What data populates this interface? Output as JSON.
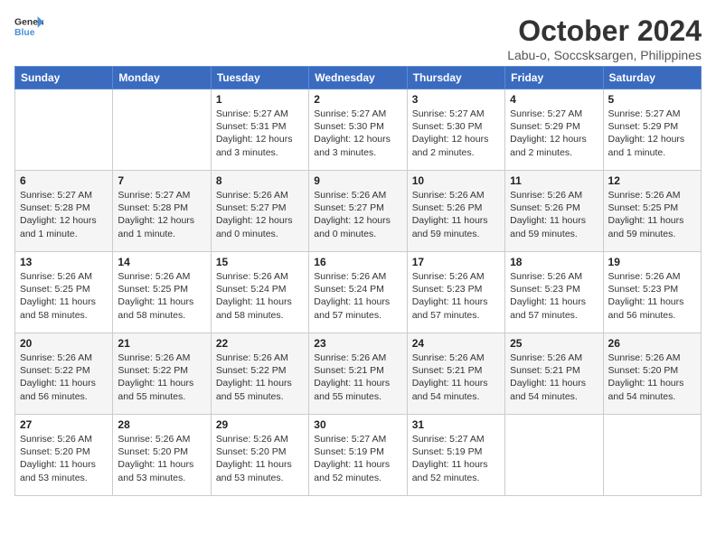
{
  "logo": {
    "line1": "General",
    "line2": "Blue"
  },
  "title": "October 2024",
  "subtitle": "Labu-o, Soccsksargen, Philippines",
  "headers": [
    "Sunday",
    "Monday",
    "Tuesday",
    "Wednesday",
    "Thursday",
    "Friday",
    "Saturday"
  ],
  "weeks": [
    [
      {
        "day": "",
        "info": ""
      },
      {
        "day": "",
        "info": ""
      },
      {
        "day": "1",
        "info": "Sunrise: 5:27 AM\nSunset: 5:31 PM\nDaylight: 12 hours\nand 3 minutes."
      },
      {
        "day": "2",
        "info": "Sunrise: 5:27 AM\nSunset: 5:30 PM\nDaylight: 12 hours\nand 3 minutes."
      },
      {
        "day": "3",
        "info": "Sunrise: 5:27 AM\nSunset: 5:30 PM\nDaylight: 12 hours\nand 2 minutes."
      },
      {
        "day": "4",
        "info": "Sunrise: 5:27 AM\nSunset: 5:29 PM\nDaylight: 12 hours\nand 2 minutes."
      },
      {
        "day": "5",
        "info": "Sunrise: 5:27 AM\nSunset: 5:29 PM\nDaylight: 12 hours\nand 1 minute."
      }
    ],
    [
      {
        "day": "6",
        "info": "Sunrise: 5:27 AM\nSunset: 5:28 PM\nDaylight: 12 hours\nand 1 minute."
      },
      {
        "day": "7",
        "info": "Sunrise: 5:27 AM\nSunset: 5:28 PM\nDaylight: 12 hours\nand 1 minute."
      },
      {
        "day": "8",
        "info": "Sunrise: 5:26 AM\nSunset: 5:27 PM\nDaylight: 12 hours\nand 0 minutes."
      },
      {
        "day": "9",
        "info": "Sunrise: 5:26 AM\nSunset: 5:27 PM\nDaylight: 12 hours\nand 0 minutes."
      },
      {
        "day": "10",
        "info": "Sunrise: 5:26 AM\nSunset: 5:26 PM\nDaylight: 11 hours\nand 59 minutes."
      },
      {
        "day": "11",
        "info": "Sunrise: 5:26 AM\nSunset: 5:26 PM\nDaylight: 11 hours\nand 59 minutes."
      },
      {
        "day": "12",
        "info": "Sunrise: 5:26 AM\nSunset: 5:25 PM\nDaylight: 11 hours\nand 59 minutes."
      }
    ],
    [
      {
        "day": "13",
        "info": "Sunrise: 5:26 AM\nSunset: 5:25 PM\nDaylight: 11 hours\nand 58 minutes."
      },
      {
        "day": "14",
        "info": "Sunrise: 5:26 AM\nSunset: 5:25 PM\nDaylight: 11 hours\nand 58 minutes."
      },
      {
        "day": "15",
        "info": "Sunrise: 5:26 AM\nSunset: 5:24 PM\nDaylight: 11 hours\nand 58 minutes."
      },
      {
        "day": "16",
        "info": "Sunrise: 5:26 AM\nSunset: 5:24 PM\nDaylight: 11 hours\nand 57 minutes."
      },
      {
        "day": "17",
        "info": "Sunrise: 5:26 AM\nSunset: 5:23 PM\nDaylight: 11 hours\nand 57 minutes."
      },
      {
        "day": "18",
        "info": "Sunrise: 5:26 AM\nSunset: 5:23 PM\nDaylight: 11 hours\nand 57 minutes."
      },
      {
        "day": "19",
        "info": "Sunrise: 5:26 AM\nSunset: 5:23 PM\nDaylight: 11 hours\nand 56 minutes."
      }
    ],
    [
      {
        "day": "20",
        "info": "Sunrise: 5:26 AM\nSunset: 5:22 PM\nDaylight: 11 hours\nand 56 minutes."
      },
      {
        "day": "21",
        "info": "Sunrise: 5:26 AM\nSunset: 5:22 PM\nDaylight: 11 hours\nand 55 minutes."
      },
      {
        "day": "22",
        "info": "Sunrise: 5:26 AM\nSunset: 5:22 PM\nDaylight: 11 hours\nand 55 minutes."
      },
      {
        "day": "23",
        "info": "Sunrise: 5:26 AM\nSunset: 5:21 PM\nDaylight: 11 hours\nand 55 minutes."
      },
      {
        "day": "24",
        "info": "Sunrise: 5:26 AM\nSunset: 5:21 PM\nDaylight: 11 hours\nand 54 minutes."
      },
      {
        "day": "25",
        "info": "Sunrise: 5:26 AM\nSunset: 5:21 PM\nDaylight: 11 hours\nand 54 minutes."
      },
      {
        "day": "26",
        "info": "Sunrise: 5:26 AM\nSunset: 5:20 PM\nDaylight: 11 hours\nand 54 minutes."
      }
    ],
    [
      {
        "day": "27",
        "info": "Sunrise: 5:26 AM\nSunset: 5:20 PM\nDaylight: 11 hours\nand 53 minutes."
      },
      {
        "day": "28",
        "info": "Sunrise: 5:26 AM\nSunset: 5:20 PM\nDaylight: 11 hours\nand 53 minutes."
      },
      {
        "day": "29",
        "info": "Sunrise: 5:26 AM\nSunset: 5:20 PM\nDaylight: 11 hours\nand 53 minutes."
      },
      {
        "day": "30",
        "info": "Sunrise: 5:27 AM\nSunset: 5:19 PM\nDaylight: 11 hours\nand 52 minutes."
      },
      {
        "day": "31",
        "info": "Sunrise: 5:27 AM\nSunset: 5:19 PM\nDaylight: 11 hours\nand 52 minutes."
      },
      {
        "day": "",
        "info": ""
      },
      {
        "day": "",
        "info": ""
      }
    ]
  ]
}
